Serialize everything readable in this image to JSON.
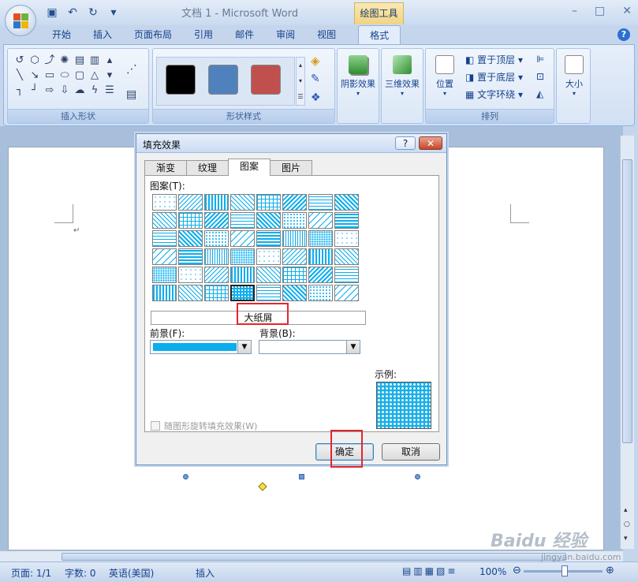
{
  "window": {
    "title": "文档 1 - Microsoft Word",
    "context_tab_group": "绘图工具"
  },
  "quick_access": {
    "save_icon": "save-icon",
    "undo_icon": "undo-icon",
    "redo_icon": "redo-icon",
    "more": "▾"
  },
  "tabs": [
    {
      "label": "开始"
    },
    {
      "label": "插入"
    },
    {
      "label": "页面布局"
    },
    {
      "label": "引用"
    },
    {
      "label": "邮件"
    },
    {
      "label": "审阅"
    },
    {
      "label": "视图"
    },
    {
      "label": "格式",
      "active": true
    }
  ],
  "ribbon": {
    "insert_shapes": {
      "label": "插入形状"
    },
    "shape_styles": {
      "label": "形状样式",
      "swatches": [
        "#000000",
        "#4f81bd",
        "#c0504d"
      ]
    },
    "shadow_effect": {
      "label": "阴影效果"
    },
    "three_d_effect": {
      "label": "三维效果"
    },
    "arrange": {
      "label": "排列",
      "position": "位置",
      "bring_to_front": "置于顶层",
      "send_to_back": "置于底层",
      "text_wrap": "文字环绕"
    },
    "size": {
      "label": "大小"
    }
  },
  "dialog": {
    "title": "填充效果",
    "help": "?",
    "close": "✕",
    "tabs": [
      {
        "label": "渐变"
      },
      {
        "label": "纹理"
      },
      {
        "label": "图案",
        "active": true
      },
      {
        "label": "图片"
      }
    ],
    "pattern_label": "图案(T):",
    "selected_pattern_name": "大纸屑",
    "foreground_label": "前景(F):",
    "foreground_color": "#0aaeef",
    "background_label": "背景(B):",
    "sample_label": "示例:",
    "rotate_checkbox_label": "随图形旋转填充效果(W)",
    "ok_button": "确定",
    "cancel_button": "取消"
  },
  "status_bar": {
    "page": "页面: 1/1",
    "words": "字数: 0",
    "language": "英语(美国)",
    "mode": "插入",
    "zoom": "100%"
  },
  "watermark": {
    "text": "Baidu 经验",
    "sub": "jingyan.baidu.com"
  }
}
